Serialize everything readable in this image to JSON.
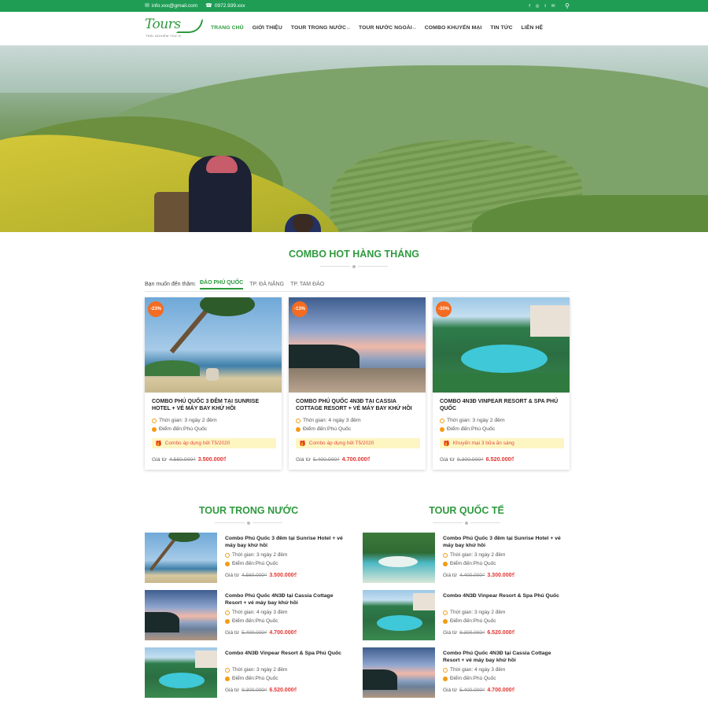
{
  "topbar": {
    "email": "info.xxx@gmail.com",
    "phone": "0972.939.xxx",
    "social_icons": [
      "facebook-icon",
      "instagram-icon",
      "twitter-icon",
      "email-icon"
    ],
    "search_icon": "search-icon"
  },
  "logo": {
    "text": "Tours",
    "slogan": "TRẢI NGHIỆM THÚ VỊ"
  },
  "nav": {
    "items": [
      {
        "label": "TRANG CHỦ",
        "active": true
      },
      {
        "label": "GIỚI THIỆU"
      },
      {
        "label": "TOUR TRONG NƯỚC",
        "dropdown": true
      },
      {
        "label": "TOUR NƯỚC NGOÀI",
        "dropdown": true
      },
      {
        "label": "COMBO KHUYẾN MẠI"
      },
      {
        "label": "TIN TỨC"
      },
      {
        "label": "LIÊN HỆ"
      }
    ]
  },
  "hero": {
    "slides": 3,
    "active_slide": 1
  },
  "combo": {
    "title": "COMBO HOT HÀNG THÁNG",
    "filter_label": "Bạn muốn đến thăm:",
    "tabs": [
      "ĐẢO PHÚ QUỐC",
      "TP. ĐÀ NẴNG",
      "TP. TAM ĐẢO"
    ],
    "cards": [
      {
        "badge": "-23%",
        "title": "COMBO PHÚ QUỐC 3 ĐÊM TẠI SUNRISE HOTEL + VÉ MÁY BAY KHỨ HỒI",
        "duration": "Thời gian: 3 ngày 2 đêm",
        "destination": "Điểm đến:Phú Quốc",
        "promo": "Combo áp dụng hết T5/2020",
        "price_label": "Giá từ",
        "old_price": "4.560.000₫",
        "new_price": "3.500.000₫"
      },
      {
        "badge": "-13%",
        "title": "COMBO PHÚ QUỐC 4N3Đ TẠI CASSIA COTTAGE RESORT + VÉ MÁY BAY KHỨ HỒI",
        "duration": "Thời gian: 4 ngày 3 đêm",
        "destination": "Điểm đến:Phú Quốc",
        "promo": "Combo áp dụng hết T5/2020",
        "price_label": "Giá từ",
        "old_price": "5.400.000₫",
        "new_price": "4.700.000₫"
      },
      {
        "badge": "-30%",
        "title": "COMBO 4N3Đ VINPEAR RESORT & SPA PHÚ QUỐC",
        "duration": "Thời gian: 3 ngày 2 đêm",
        "destination": "Điểm đến:Phú Quốc",
        "promo": "Khuyến mại 3 bữa ăn sáng",
        "price_label": "Giá từ",
        "old_price": "9.300.000₫",
        "new_price": "6.520.000₫"
      }
    ]
  },
  "domestic": {
    "title": "TOUR TRONG NƯỚC",
    "items": [
      {
        "title": "Combo Phú Quốc 3 đêm tại Sunrise Hotel + vé máy bay khứ hồi",
        "duration": "Thời gian: 3 ngày 2 đêm",
        "destination": "Điểm đến:Phú Quốc",
        "price_label": "Giá từ",
        "old_price": "4.560.000₫",
        "new_price": "3.500.000₫"
      },
      {
        "title": "Combo Phú Quốc 4N3Đ tại Cassia Cottage Resort + vé máy bay khứ hồi",
        "duration": "Thời gian: 4 ngày 3 đêm",
        "destination": "Điểm đến:Phú Quốc",
        "price_label": "Giá từ",
        "old_price": "5.400.000₫",
        "new_price": "4.700.000₫"
      },
      {
        "title": "Combo 4N3Đ Vinpear Resort & Spa Phú Quốc",
        "duration": "Thời gian: 3 ngày 2 đêm",
        "destination": "Điểm đến:Phú Quốc",
        "price_label": "Giá từ",
        "old_price": "9.300.000₫",
        "new_price": "6.520.000₫"
      }
    ]
  },
  "international": {
    "title": "TOUR QUỐC TẾ",
    "items": [
      {
        "title": "Combo Phú Quốc 3 đêm tại Sunrise Hotel + vé máy bay khứ hồi",
        "duration": "Thời gian: 3 ngày 2 đêm",
        "destination": "Điểm đến:Phú Quốc",
        "price_label": "Giá từ",
        "old_price": "4.400.000₫",
        "new_price": "3.300.000₫"
      },
      {
        "title": "Combo 4N3Đ Vinpear Resort & Spa Phú Quốc",
        "duration": "Thời gian: 3 ngày 2 đêm",
        "destination": "Điểm đến:Phú Quốc",
        "price_label": "Giá từ",
        "old_price": "9.300.000₫",
        "new_price": "6.520.000₫"
      },
      {
        "title": "Combo Phú Quốc 4N3Đ tại Cassia Cottage Resort + vé máy bay khứ hồi",
        "duration": "Thời gian: 4 ngày 3 đêm",
        "destination": "Điểm đến:Phú Quốc",
        "price_label": "Giá từ",
        "old_price": "5.400.000₫",
        "new_price": "4.700.000₫"
      }
    ]
  },
  "colors": {
    "brand_green": "#2e9a3e",
    "topbar_green": "#1f9d55",
    "badge_orange": "#f36c21",
    "price_red": "#e3342f",
    "promo_bg": "#fdf6c3"
  }
}
